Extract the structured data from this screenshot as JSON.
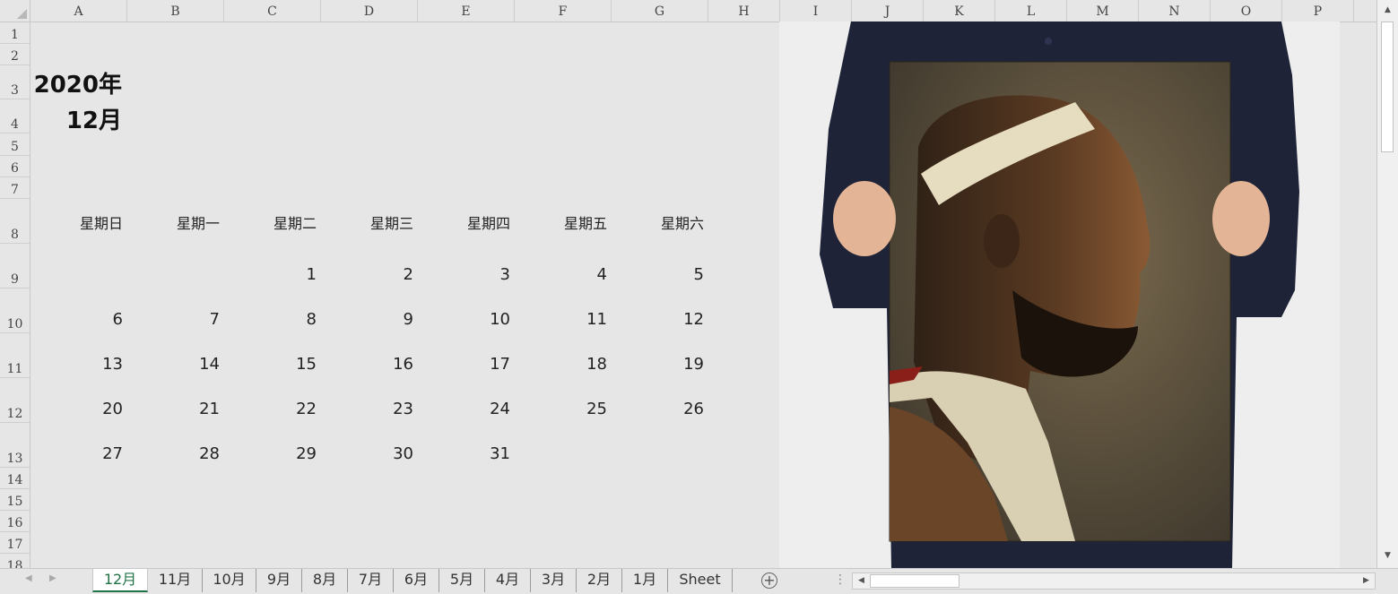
{
  "columns": [
    "A",
    "B",
    "C",
    "D",
    "E",
    "F",
    "G",
    "H",
    "I",
    "J",
    "K",
    "L",
    "M",
    "N",
    "O",
    "P"
  ],
  "rows": [
    "1",
    "2",
    "3",
    "4",
    "5",
    "6",
    "7",
    "8",
    "9",
    "10",
    "11",
    "12",
    "13",
    "14",
    "15",
    "16",
    "17",
    "18"
  ],
  "calendar": {
    "year_label": "2020年",
    "month_label": "12月",
    "weekdays": [
      "星期日",
      "星期一",
      "星期二",
      "星期三",
      "星期四",
      "星期五",
      "星期六"
    ],
    "weeks": [
      [
        "",
        "",
        "1",
        "2",
        "3",
        "4",
        "5"
      ],
      [
        "6",
        "7",
        "8",
        "9",
        "10",
        "11",
        "12"
      ],
      [
        "13",
        "14",
        "15",
        "16",
        "17",
        "18",
        "19"
      ],
      [
        "20",
        "21",
        "22",
        "23",
        "24",
        "25",
        "26"
      ],
      [
        "27",
        "28",
        "29",
        "30",
        "31",
        "",
        ""
      ]
    ]
  },
  "tabs": [
    "12月",
    "11月",
    "10月",
    "9月",
    "8月",
    "7月",
    "6月",
    "5月",
    "4月",
    "3月",
    "2月",
    "1月",
    "Sheet"
  ],
  "active_tab": "12月",
  "icons": {
    "nav_prev": "triangle-left-icon",
    "nav_next": "triangle-right-icon",
    "add_sheet": "plus-circle-icon",
    "scroll_up": "triangle-up-icon",
    "scroll_down": "triangle-down-icon",
    "scroll_left": "triangle-left-icon",
    "scroll_right": "triangle-right-icon"
  },
  "colors": {
    "accent": "#217346",
    "sheet_bg": "#e6e6e6"
  }
}
